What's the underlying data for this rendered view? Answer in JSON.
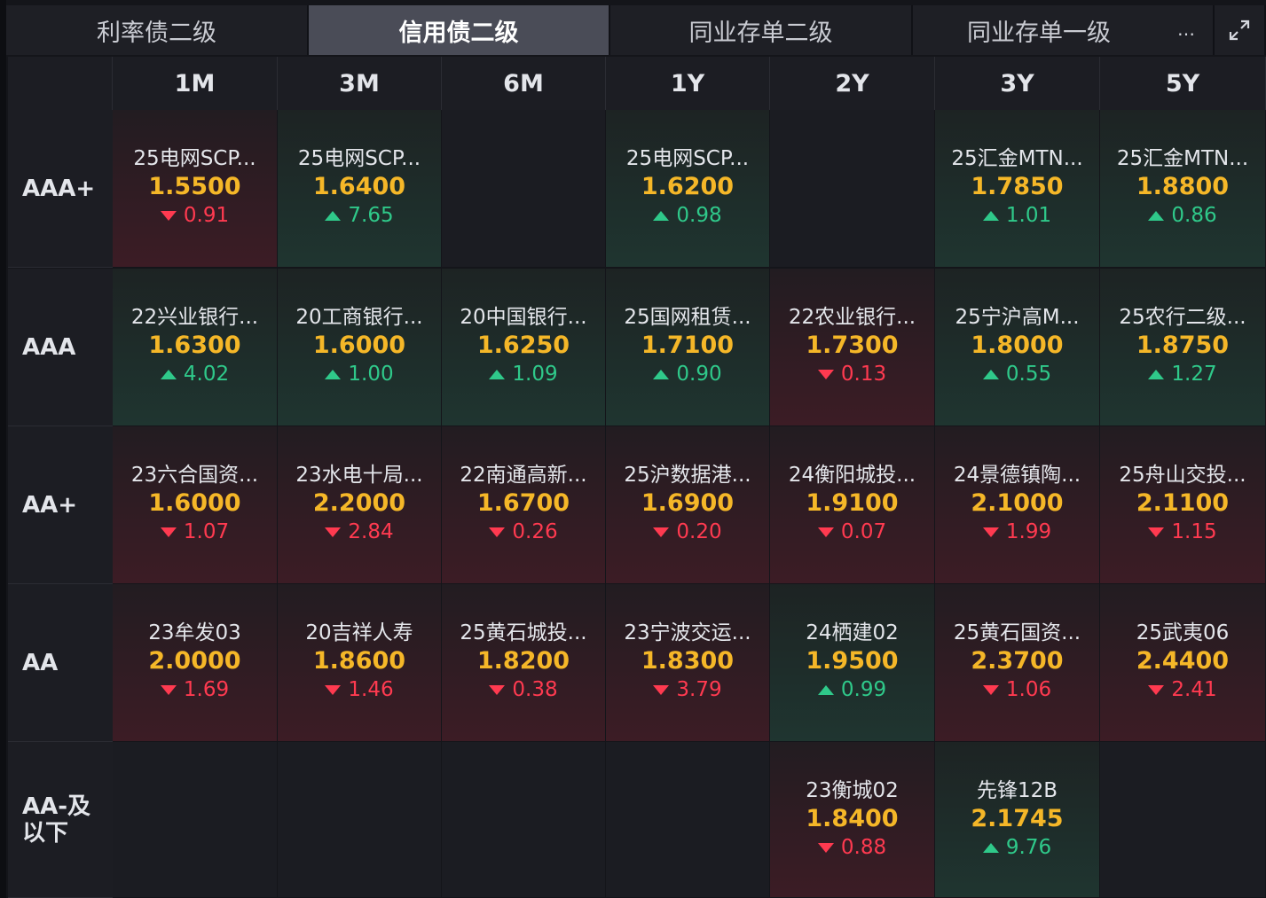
{
  "tabs": [
    {
      "label": "利率债二级",
      "active": false
    },
    {
      "label": "信用债二级",
      "active": true
    },
    {
      "label": "同业存单二级",
      "active": false
    },
    {
      "label": "同业存单一级",
      "active": false
    }
  ],
  "more_icon": "…",
  "expand_icon": "expand-icon",
  "columns": [
    "1M",
    "3M",
    "6M",
    "1Y",
    "2Y",
    "3Y",
    "5Y"
  ],
  "rows": [
    {
      "rating": "AAA+",
      "cells": [
        {
          "name": "25电网SCP...",
          "yield": "1.5500",
          "change": "0.91",
          "dir": "down"
        },
        {
          "name": "25电网SCP...",
          "yield": "1.6400",
          "change": "7.65",
          "dir": "up"
        },
        null,
        {
          "name": "25电网SCP...",
          "yield": "1.6200",
          "change": "0.98",
          "dir": "up"
        },
        null,
        {
          "name": "25汇金MTN...",
          "yield": "1.7850",
          "change": "1.01",
          "dir": "up"
        },
        {
          "name": "25汇金MTN...",
          "yield": "1.8800",
          "change": "0.86",
          "dir": "up"
        }
      ]
    },
    {
      "rating": "AAA",
      "cells": [
        {
          "name": "22兴业银行...",
          "yield": "1.6300",
          "change": "4.02",
          "dir": "up"
        },
        {
          "name": "20工商银行...",
          "yield": "1.6000",
          "change": "1.00",
          "dir": "up"
        },
        {
          "name": "20中国银行...",
          "yield": "1.6250",
          "change": "1.09",
          "dir": "up"
        },
        {
          "name": "25国网租赁...",
          "yield": "1.7100",
          "change": "0.90",
          "dir": "up"
        },
        {
          "name": "22农业银行...",
          "yield": "1.7300",
          "change": "0.13",
          "dir": "down"
        },
        {
          "name": "25宁沪高M...",
          "yield": "1.8000",
          "change": "0.55",
          "dir": "up"
        },
        {
          "name": "25农行二级...",
          "yield": "1.8750",
          "change": "1.27",
          "dir": "up"
        }
      ]
    },
    {
      "rating": "AA+",
      "cells": [
        {
          "name": "23六合国资...",
          "yield": "1.6000",
          "change": "1.07",
          "dir": "down"
        },
        {
          "name": "23水电十局...",
          "yield": "2.2000",
          "change": "2.84",
          "dir": "down"
        },
        {
          "name": "22南通高新...",
          "yield": "1.6700",
          "change": "0.26",
          "dir": "down"
        },
        {
          "name": "25沪数据港...",
          "yield": "1.6900",
          "change": "0.20",
          "dir": "down"
        },
        {
          "name": "24衡阳城投...",
          "yield": "1.9100",
          "change": "0.07",
          "dir": "down"
        },
        {
          "name": "24景德镇陶...",
          "yield": "2.1000",
          "change": "1.99",
          "dir": "down"
        },
        {
          "name": "25舟山交投...",
          "yield": "2.1100",
          "change": "1.15",
          "dir": "down"
        }
      ]
    },
    {
      "rating": "AA",
      "cells": [
        {
          "name": "23牟发03",
          "yield": "2.0000",
          "change": "1.69",
          "dir": "down"
        },
        {
          "name": "20吉祥人寿",
          "yield": "1.8600",
          "change": "1.46",
          "dir": "down"
        },
        {
          "name": "25黄石城投...",
          "yield": "1.8200",
          "change": "0.38",
          "dir": "down"
        },
        {
          "name": "23宁波交运...",
          "yield": "1.8300",
          "change": "3.79",
          "dir": "down"
        },
        {
          "name": "24栖建02",
          "yield": "1.9500",
          "change": "0.99",
          "dir": "up"
        },
        {
          "name": "25黄石国资...",
          "yield": "2.3700",
          "change": "1.06",
          "dir": "down"
        },
        {
          "name": "25武夷06",
          "yield": "2.4400",
          "change": "2.41",
          "dir": "down"
        }
      ]
    },
    {
      "rating": "AA-及以下",
      "rating_lines": [
        "AA-及",
        "以下"
      ],
      "cells": [
        null,
        null,
        null,
        null,
        {
          "name": "23衡城02",
          "yield": "1.8400",
          "change": "0.88",
          "dir": "down"
        },
        {
          "name": "先锋12B",
          "yield": "2.1745",
          "change": "9.76",
          "dir": "up"
        },
        null
      ]
    }
  ],
  "colors": {
    "up": "#2fc98a",
    "down": "#ff3a50",
    "yield": "#f5b728",
    "active_tab": "#4a4c57"
  }
}
